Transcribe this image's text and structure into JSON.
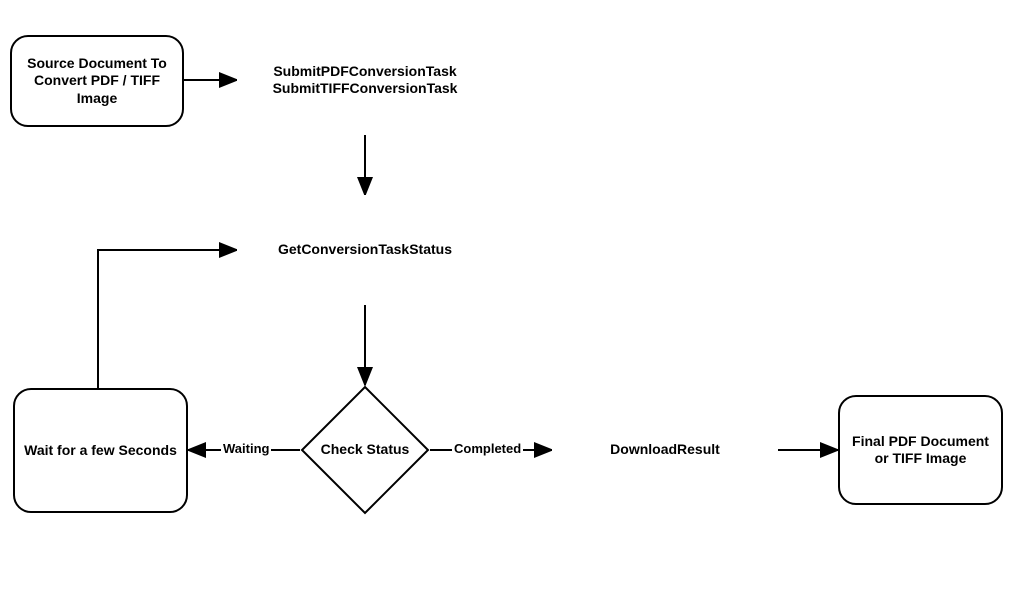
{
  "chart_data": {
    "type": "flowchart",
    "nodes": [
      {
        "id": "source",
        "shape": "rounded-rect",
        "label": "Source Document To Convert PDF / TIFF Image"
      },
      {
        "id": "submit",
        "shape": "hexagon",
        "label_line1": "SubmitPDFConversionTask",
        "label_line2": "SubmitTIFFConversionTask"
      },
      {
        "id": "status",
        "shape": "hexagon",
        "label": "GetConversionTaskStatus"
      },
      {
        "id": "check",
        "shape": "diamond",
        "label": "Check Status"
      },
      {
        "id": "wait",
        "shape": "rounded-rect",
        "label": "Wait for a few Seconds"
      },
      {
        "id": "download",
        "shape": "hexagon",
        "label": "DownloadResult"
      },
      {
        "id": "final",
        "shape": "rounded-rect",
        "label": "Final PDF Document or TIFF Image"
      }
    ],
    "edges": [
      {
        "from": "source",
        "to": "submit",
        "label": ""
      },
      {
        "from": "submit",
        "to": "status",
        "label": ""
      },
      {
        "from": "status",
        "to": "check",
        "label": ""
      },
      {
        "from": "check",
        "to": "wait",
        "label": "Waiting"
      },
      {
        "from": "wait",
        "to": "status",
        "label": ""
      },
      {
        "from": "check",
        "to": "download",
        "label": "Completed"
      },
      {
        "from": "download",
        "to": "final",
        "label": ""
      }
    ]
  }
}
